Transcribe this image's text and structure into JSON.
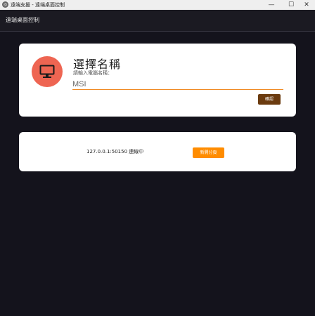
{
  "window": {
    "title": "遠端支援 - 遠端桌面控制",
    "minimize_glyph": "—",
    "maximize_glyph": "☐",
    "close_glyph": "✕"
  },
  "appbar": {
    "title": "遠端桌面控制"
  },
  "name_card": {
    "icon": "monitor-icon",
    "heading": "選擇名稱",
    "subtext": "請輸入電腦名稱：",
    "input_value": "MSI",
    "confirm_label": "確認",
    "accent_color": "#ee6552"
  },
  "connection_card": {
    "status_text": "127.0.0.1:50150 連線中",
    "new_connection_label": "新開分頁"
  }
}
